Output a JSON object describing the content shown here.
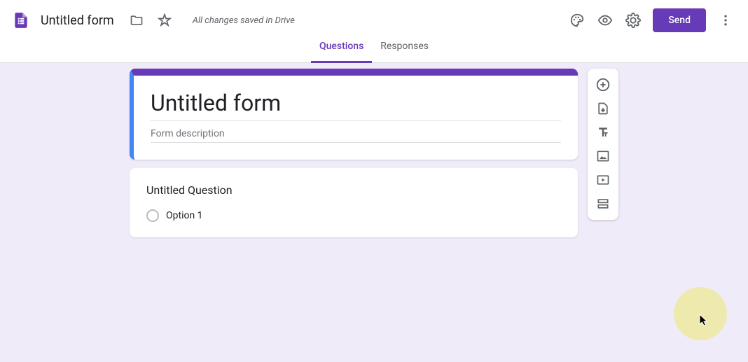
{
  "header": {
    "doc_title": "Untitled form",
    "save_status": "All changes saved in Drive",
    "send_label": "Send"
  },
  "tabs": {
    "questions": "Questions",
    "responses": "Responses"
  },
  "form": {
    "title": "Untitled form",
    "description_placeholder": "Form description",
    "question_title": "Untitled Question",
    "option_label": "Option 1"
  },
  "colors": {
    "accent": "#673ab7",
    "highlight_border": "#4285f4",
    "background": "#f0ebf8"
  }
}
